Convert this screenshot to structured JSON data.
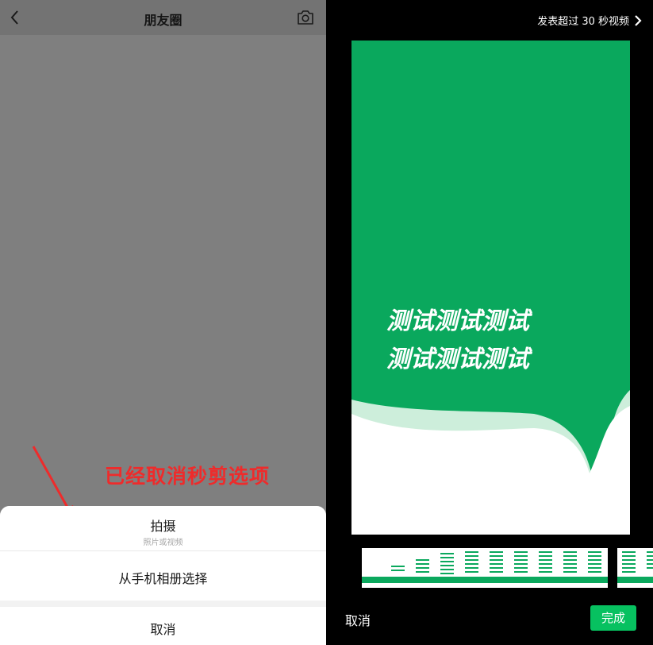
{
  "left": {
    "header": {
      "title": "朋友圈",
      "back_icon": "chevron-left-icon",
      "camera_icon": "camera-icon"
    },
    "annotation": {
      "text": "已经取消秒剪选项",
      "color": "#ee2b2b"
    },
    "action_sheet": {
      "option_capture_label": "拍摄",
      "option_capture_sub": "照片或视频",
      "option_album_label": "从手机相册选择",
      "cancel_label": "取消"
    }
  },
  "right": {
    "post_link_label": "发表超过 30 秒视频",
    "preview": {
      "line1": "测试测试测试",
      "line2": "测试测试测试",
      "bg_color": "#0aa85d"
    },
    "cancel_label": "取消",
    "done_label": "完成",
    "accent_color": "#07c160"
  }
}
